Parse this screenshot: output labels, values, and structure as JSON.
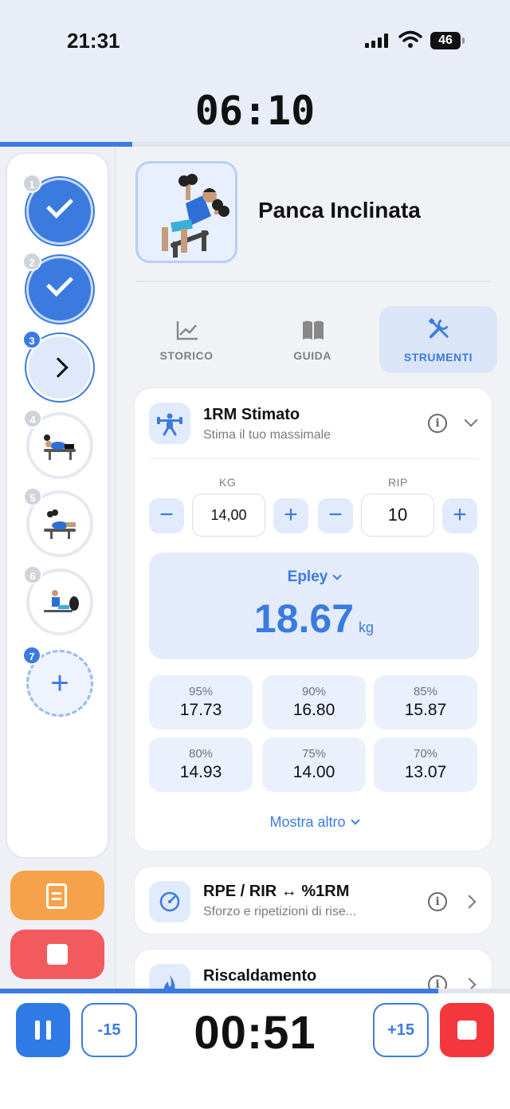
{
  "status_bar": {
    "time": "21:31",
    "battery": "46"
  },
  "workout": {
    "elapsed": "06:10",
    "progress_pct": 26
  },
  "sidebar": {
    "exercises": [
      {
        "num": "1",
        "state": "done"
      },
      {
        "num": "2",
        "state": "done"
      },
      {
        "num": "3",
        "state": "current"
      },
      {
        "num": "4",
        "state": "pending"
      },
      {
        "num": "5",
        "state": "pending"
      },
      {
        "num": "6",
        "state": "pending"
      },
      {
        "num": "7",
        "state": "add"
      }
    ],
    "notes_icon": "notes-edit-icon",
    "stop_icon": "stop-icon"
  },
  "exercise": {
    "title": "Panca Inclinata"
  },
  "tabs": [
    {
      "label": "STORICO",
      "icon": "chart-icon",
      "active": false
    },
    {
      "label": "GUIDA",
      "icon": "book-icon",
      "active": false
    },
    {
      "label": "STRUMENTI",
      "icon": "tools-icon",
      "active": true
    }
  ],
  "tool_1rm": {
    "title": "1RM Stimato",
    "subtitle": "Stima il tuo massimale",
    "kg_label": "KG",
    "rip_label": "RIP",
    "kg_value": "14,00",
    "rip_value": "10",
    "minus": "−",
    "plus": "+",
    "formula": "Epley",
    "result": "18.67",
    "unit": "kg",
    "percentages": [
      {
        "p": "95%",
        "v": "17.73"
      },
      {
        "p": "90%",
        "v": "16.80"
      },
      {
        "p": "85%",
        "v": "15.87"
      },
      {
        "p": "80%",
        "v": "14.93"
      },
      {
        "p": "75%",
        "v": "14.00"
      },
      {
        "p": "70%",
        "v": "13.07"
      }
    ],
    "show_more": "Mostra altro"
  },
  "tool_rpe": {
    "title": "RPE / RIR ↔ %1RM",
    "subtitle": "Sforzo e ripetizioni di rise..."
  },
  "tool_warmup": {
    "title": "Riscaldamento"
  },
  "rest_timer": {
    "time": "00:51",
    "minus_label": "-15",
    "plus_label": "+15",
    "progress_pct": 86
  },
  "colors": {
    "accent": "#3b7be0",
    "orange": "#f6a24a",
    "red": "#f4373c"
  }
}
